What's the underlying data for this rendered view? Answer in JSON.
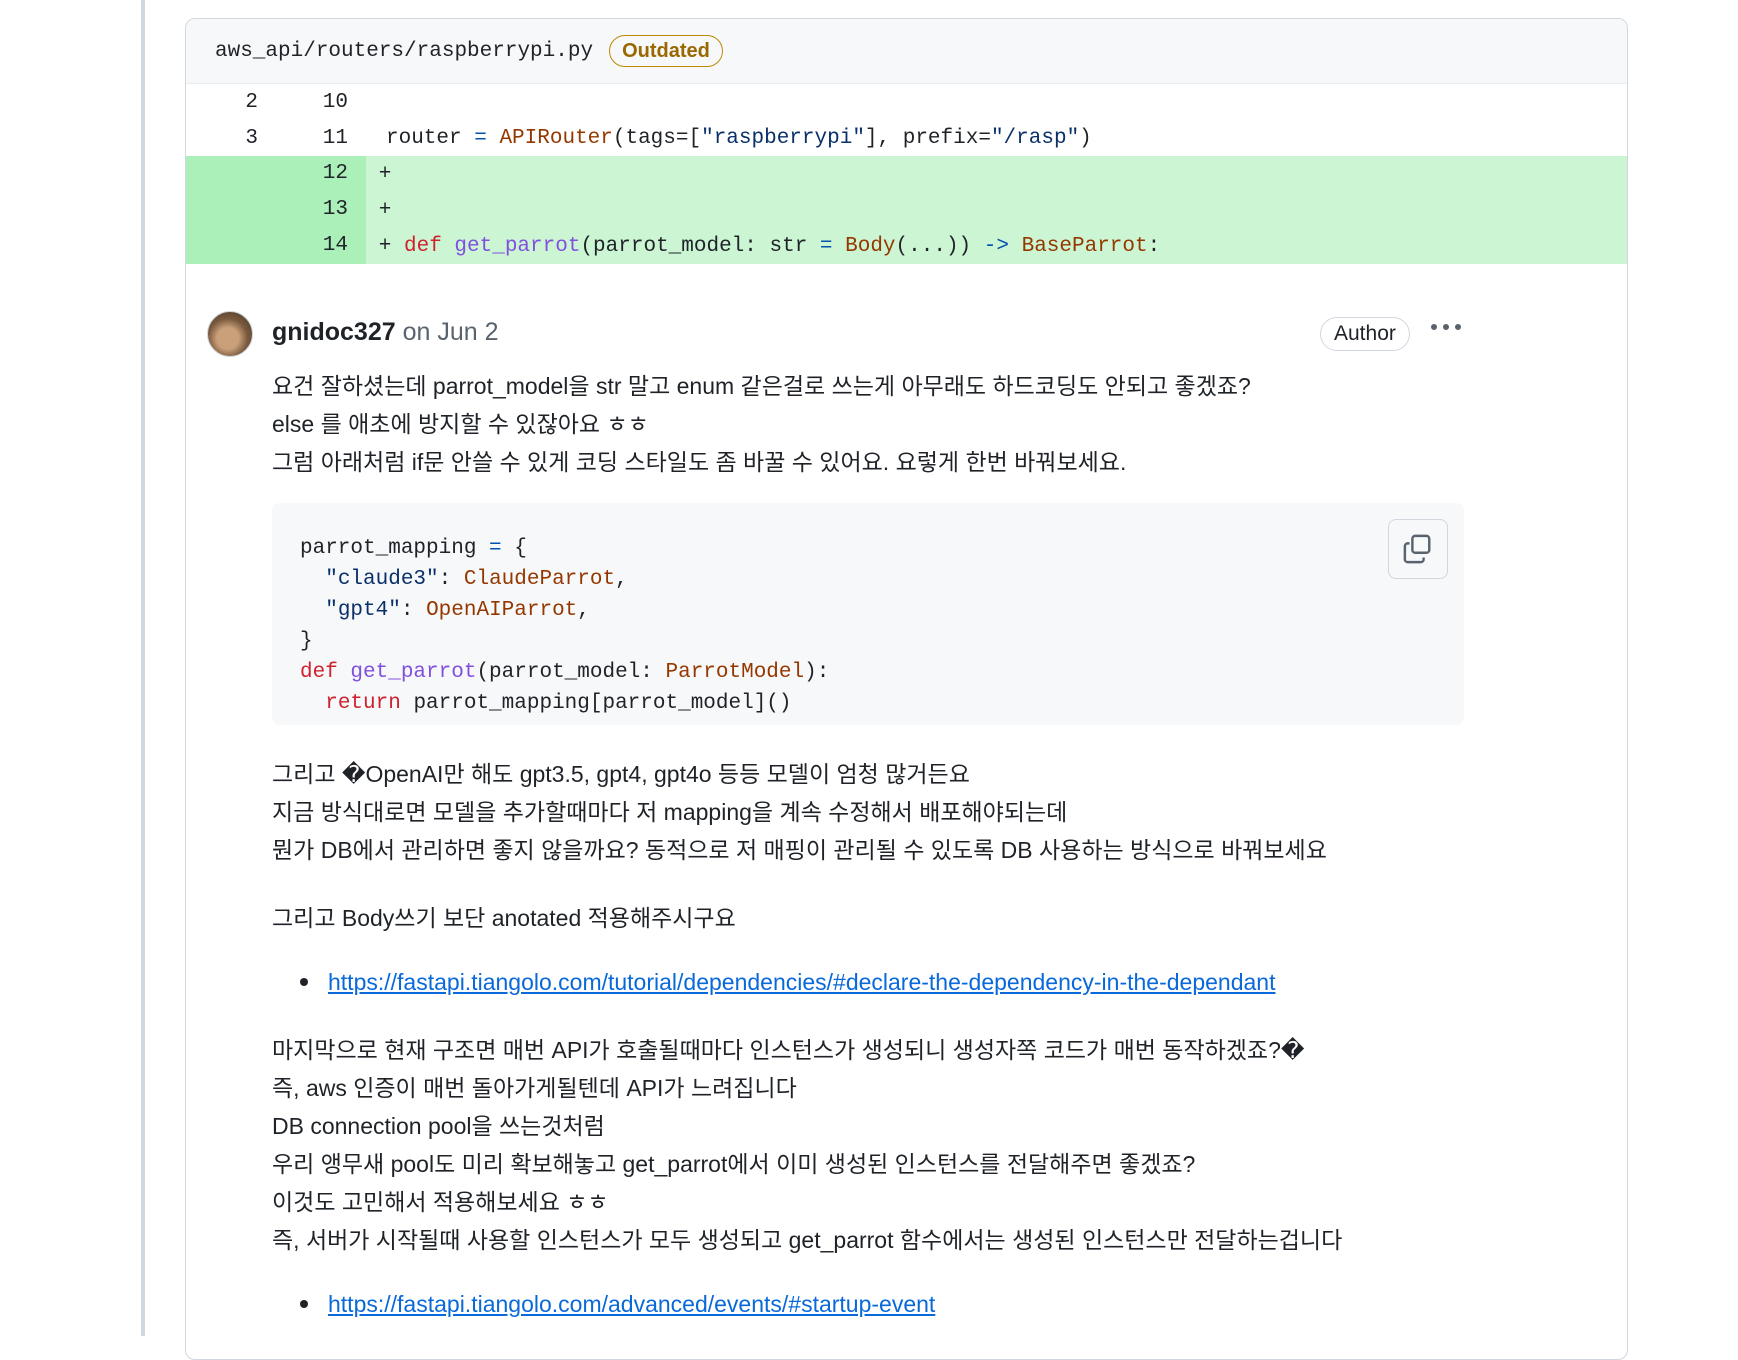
{
  "file": {
    "path": "aws_api/routers/raspberrypi.py",
    "badge": "Outdated"
  },
  "diff": {
    "row1": {
      "old": "2",
      "new": "10"
    },
    "row2": {
      "old": "3",
      "new": "11",
      "code_router": "router",
      "code_eq": "=",
      "code_cls": "APIRouter",
      "code_open": "(tags=[",
      "code_str1": "\"raspberrypi\"",
      "code_mid": "], prefix=",
      "code_str2": "\"/rasp\"",
      "code_close": ")"
    },
    "row3": {
      "new": "12",
      "marker": "+"
    },
    "row4": {
      "new": "13",
      "marker": "+"
    },
    "row5": {
      "new": "14",
      "marker": "+",
      "kw_def": "def",
      "fn": "get_parrot",
      "args": "(parrot_model: str ",
      "eq": "=",
      "body": "Body",
      "body_args": "(...)) ",
      "arrow": "->",
      "ret": "BaseParrot",
      "colon": ":"
    }
  },
  "comment": {
    "author": "gnidoc327",
    "date": "on Jun 2",
    "badge": "Author",
    "lines_intro": [
      "요건 잘하셨는데 parrot_model을 str 말고 enum 같은걸로 쓰는게 아무래도 하드코딩도 안되고 좋겠죠?",
      "else 를 애초에 방지할 수 있잖아요 ㅎㅎ",
      "그럼 아래처럼 if문 안쓸 수 있게 코딩 스타일도 좀 바꿀 수 있어요. 요렇게 한번 바꿔보세요."
    ],
    "code": {
      "l1_a": "parrot_mapping ",
      "l1_eq": "=",
      "l1_b": " {",
      "l2_str": "\"claude3\"",
      "l2_colon": ": ",
      "l2_cls": "ClaudeParrot",
      "l2_comma": ",",
      "l3_str": "\"gpt4\"",
      "l3_colon": ": ",
      "l3_cls": "OpenAIParrot",
      "l3_comma": ",",
      "l4": "}",
      "l5_kw": "def",
      "l5_fn": "get_parrot",
      "l5_a": "(parrot_model: ",
      "l5_cls": "ParrotModel",
      "l5_b": "):",
      "l6_kw": "return",
      "l6_rest": " parrot_mapping[parrot_model]()"
    },
    "lines_models": [
      "그리고 �OpenAI만 해도 gpt3.5, gpt4, gpt4o 등등 모델이 엄청 많거든요",
      "지금 방식대로면 모델을 추가할때마다 저 mapping을 계속 수정해서 배포해야되는데",
      "뭔가 DB에서 관리하면 좋지 않을까요? 동적으로 저 매핑이 관리될 수 있도록 DB 사용하는 방식으로 바꿔보세요"
    ],
    "line_body": "그리고 Body쓰기 보단 anotated 적용해주시구요",
    "link1": "https://fastapi.tiangolo.com/tutorial/dependencies/#declare-the-dependency-in-the-dependant",
    "lines_last": [
      "마지막으로 현재 구조면 매번 API가 호출될때마다 인스턴스가 생성되니 생성자쪽 코드가 매번 동작하겠죠?�",
      "즉, aws 인증이 매번 돌아가게될텐데 API가 느려집니다",
      "DB connection pool을 쓰는것처럼",
      "우리 앵무새 pool도 미리 확보해놓고 get_parrot에서 이미 생성된 인스턴스를 전달해주면 좋겠죠?",
      "이것도 고민해서 적용해보세요 ㅎㅎ",
      "즉, 서버가 시작될때 사용할 인스턴스가 모두 생성되고 get_parrot 함수에서는 생성된 인스턴스만 전달하는겁니다"
    ],
    "link2": "https://fastapi.tiangolo.com/advanced/events/#startup-event"
  }
}
